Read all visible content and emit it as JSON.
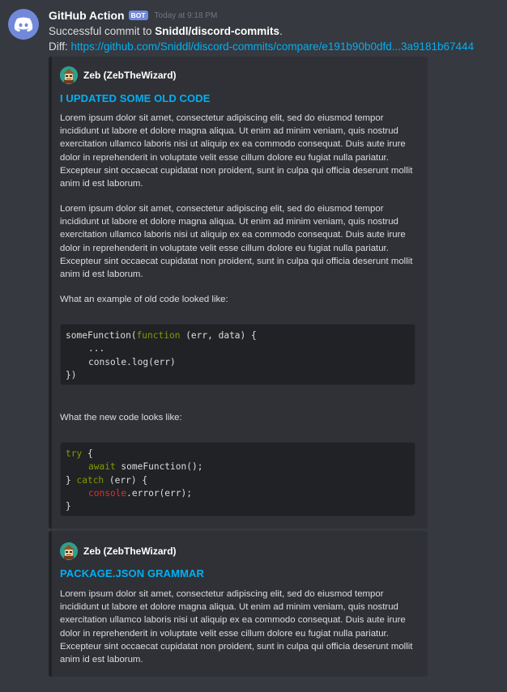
{
  "message": {
    "username": "GitHub Action",
    "bot_tag": "BOT",
    "timestamp": "Today at 9:18 PM",
    "line1_prefix": "Successful commit to ",
    "line1_repo": "Sniddl/discord-commits",
    "line1_suffix": ".",
    "diff_label": "Diff: ",
    "diff_link": "https://github.com/Sniddl/discord-commits/compare/e191b90b0dfd...3a9181b67444"
  },
  "embeds": [
    {
      "author": "Zeb (ZebTheWizard)",
      "title": "I UPDATED SOME OLD CODE",
      "paragraph1": "Lorem ipsum dolor sit amet, consectetur adipiscing elit, sed do eiusmod tempor incididunt ut labore et dolore magna aliqua. Ut enim ad minim veniam, quis nostrud exercitation ullamco laboris nisi ut aliquip ex ea commodo consequat. Duis aute irure dolor in reprehenderit in voluptate velit esse cillum dolore eu fugiat nulla pariatur. Excepteur sint occaecat cupidatat non proident, sunt in culpa qui officia deserunt mollit anim id est laborum.",
      "paragraph2": "Lorem ipsum dolor sit amet, consectetur adipiscing elit, sed do eiusmod tempor incididunt ut labore et dolore magna aliqua. Ut enim ad minim veniam, quis nostrud exercitation ullamco laboris nisi ut aliquip ex ea commodo consequat. Duis aute irure dolor in reprehenderit in voluptate velit esse cillum dolore eu fugiat nulla pariatur. Excepteur sint occaecat cupidatat non proident, sunt in culpa qui officia deserunt mollit anim id est laborum.",
      "old_code_label": "What an example of old code looked like:",
      "old_code": {
        "l1_a": "someFunction(",
        "l1_kw": "function",
        "l1_b": " (err, data) {",
        "l2": "...",
        "l3": "console.log(err)",
        "l4": "})"
      },
      "new_code_label": "What the new code looks like:",
      "new_code": {
        "l1_kw": "try",
        "l1_b": " {",
        "l2_kw": "await",
        "l2_b": " someFunction();",
        "l3_a": "} ",
        "l3_kw": "catch",
        "l3_b": " (err) {",
        "l4_er": "console",
        "l4_b": ".error(err);",
        "l5": "}"
      }
    },
    {
      "author": "Zeb (ZebTheWizard)",
      "title": "PACKAGE.JSON GRAMMAR",
      "paragraph1": "Lorem ipsum dolor sit amet, consectetur adipiscing elit, sed do eiusmod tempor incididunt ut labore et dolore magna aliqua. Ut enim ad minim veniam, quis nostrud exercitation ullamco laboris nisi ut aliquip ex ea commodo consequat. Duis aute irure dolor in reprehenderit in voluptate velit esse cillum dolore eu fugiat nulla pariatur. Excepteur sint occaecat cupidatat non proident, sunt in culpa qui officia deserunt mollit anim id est laborum."
    }
  ],
  "colors": {
    "background": "#36393f",
    "embed_background": "#2f3136",
    "link": "#00b0f4",
    "bot_tag": "#7289da",
    "code_keyword": "#859900",
    "code_error": "#dc322f"
  },
  "icons": {
    "avatar": "discord-logo-icon",
    "author": "wizard-avatar-icon"
  }
}
